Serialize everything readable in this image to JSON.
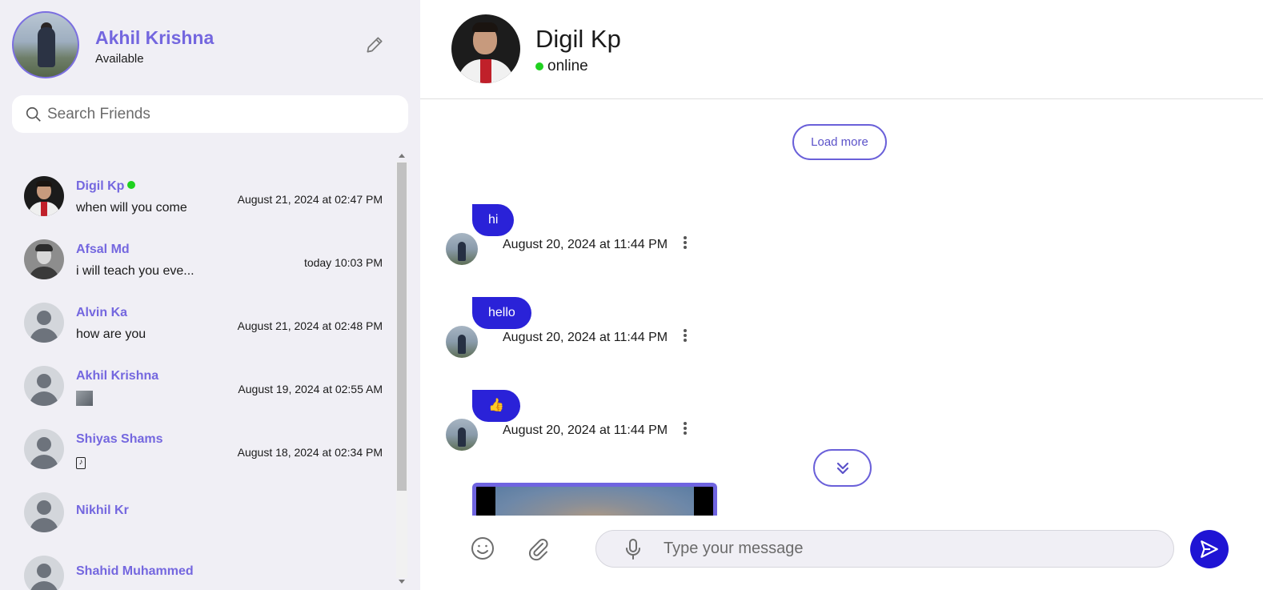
{
  "profile": {
    "name": "Akhil Krishna",
    "status": "Available",
    "avatar_icon": "profile-photo",
    "edit_icon": "pencil-icon"
  },
  "search": {
    "placeholder": "Search Friends",
    "icon": "search-icon"
  },
  "friends": [
    {
      "name": "Digil Kp",
      "online": true,
      "last_message": "when will you come",
      "time": "August 21, 2024 at 02:47 PM",
      "avatar": "photo"
    },
    {
      "name": "Afsal Md",
      "online": false,
      "last_message": "i will teach you eve...",
      "time": "today 10:03 PM",
      "avatar": "photo"
    },
    {
      "name": "Alvin Ka",
      "online": false,
      "last_message": "how are you",
      "time": "August 21, 2024 at 02:48 PM",
      "avatar": "default-user-icon"
    },
    {
      "name": "Akhil Krishna",
      "online": false,
      "last_message": "",
      "time": "August 19, 2024 at 02:55 AM",
      "avatar": "default-user-icon",
      "attachment": "image-thumbnail"
    },
    {
      "name": "Shiyas Shams",
      "online": false,
      "last_message": "",
      "time": "August 18, 2024 at 02:34 PM",
      "avatar": "default-user-icon",
      "attachment": "music-note-icon"
    },
    {
      "name": "Nikhil Kr",
      "online": false,
      "last_message": "",
      "time": "",
      "avatar": "default-user-icon"
    },
    {
      "name": "Shahid Muhammed",
      "online": false,
      "last_message": "",
      "time": "",
      "avatar": "default-user-icon"
    }
  ],
  "chat": {
    "peer_name": "Digil Kp",
    "peer_status": "online",
    "load_more_label": "Load more",
    "messages": [
      {
        "text": "hi",
        "time": "August 20, 2024 at 11:44 PM"
      },
      {
        "text": "hello",
        "time": "August 20, 2024 at 11:44 PM"
      },
      {
        "text": "👍",
        "time": "August 20, 2024 at 11:44 PM"
      }
    ],
    "image_message": "photo-attachment",
    "scroll_down_icon": "double-chevron-down-icon"
  },
  "composer": {
    "placeholder": "Type your message",
    "emoji_icon": "smiley-icon",
    "attach_icon": "paperclip-icon",
    "mic_icon": "microphone-icon",
    "send_icon": "send-icon"
  },
  "colors": {
    "accent": "#7467df",
    "bubble": "#2a22d8",
    "send": "#1f14d4",
    "sidebar_bg": "#f0eff5",
    "online": "#1fd11f"
  }
}
